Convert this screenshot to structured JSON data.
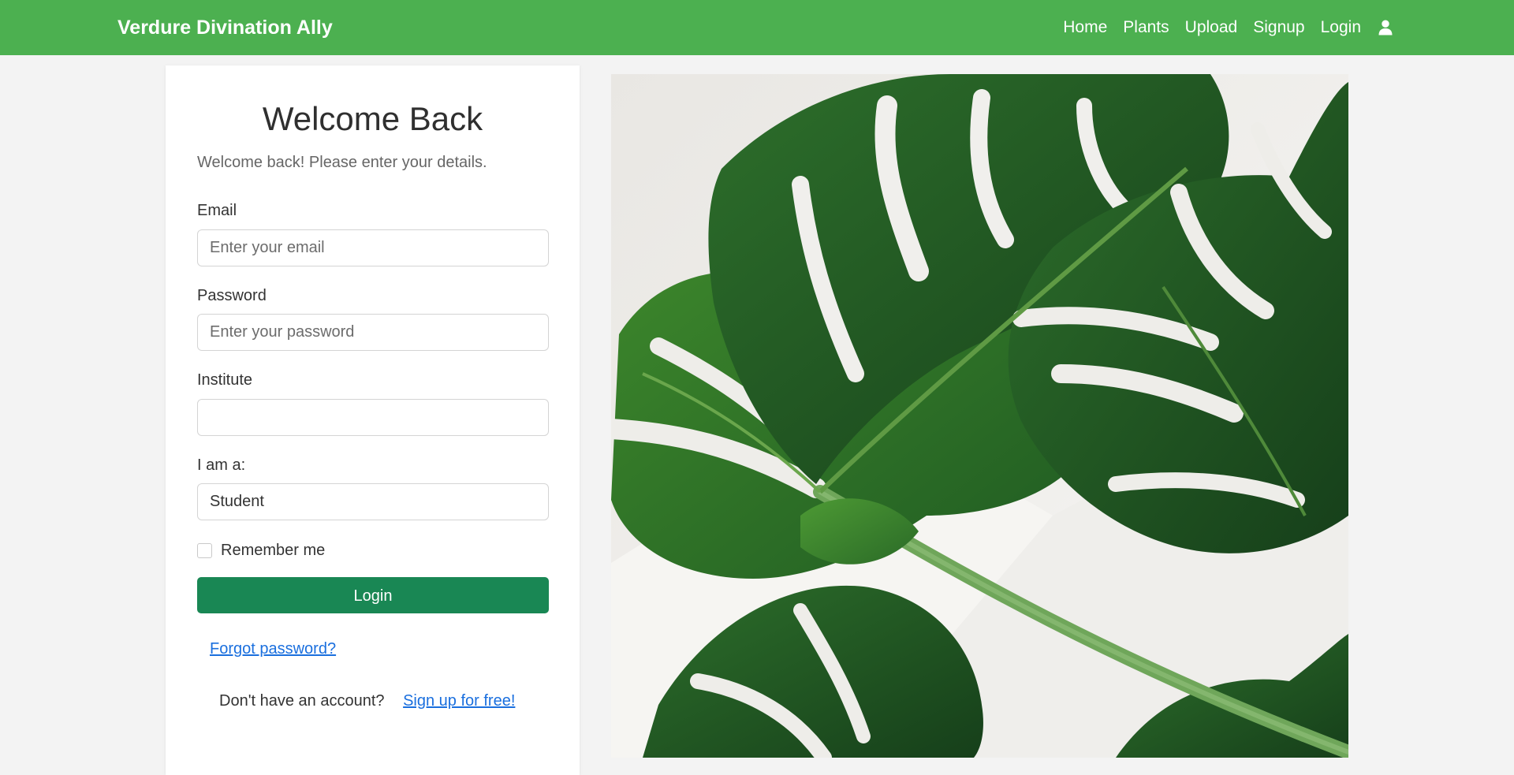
{
  "navbar": {
    "brand": "Verdure Divination Ally",
    "links": [
      "Home",
      "Plants",
      "Upload",
      "Signup",
      "Login"
    ],
    "user_icon": "user-icon",
    "bg_color": "#4cb050"
  },
  "login": {
    "title": "Welcome Back",
    "subtitle": "Welcome back! Please enter your details.",
    "email": {
      "label": "Email",
      "placeholder": "Enter your email",
      "value": ""
    },
    "password": {
      "label": "Password",
      "placeholder": "Enter your password",
      "value": ""
    },
    "institute": {
      "label": "Institute",
      "value": ""
    },
    "role": {
      "label": "I am a:",
      "selected": "Student"
    },
    "remember_label": "Remember me",
    "remember_checked": false,
    "submit_label": "Login",
    "submit_color": "#198754",
    "forgot_link": "Forgot password?",
    "no_account_text": "Don't have an account?",
    "signup_link": "Sign up for free!",
    "link_color": "#1a6fde"
  },
  "hero": {
    "image_subject": "monstera-leaves-photo"
  }
}
